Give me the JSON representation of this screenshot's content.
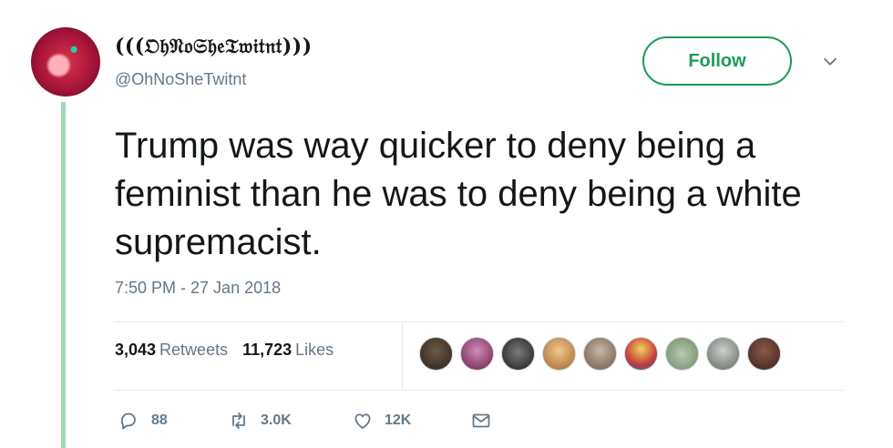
{
  "tweet": {
    "display_name": "(((𝔒𝔥𝔑𝔬𝔖𝔥𝔢𝔗𝔴𝔦𝔱𝔫𝔱)))",
    "handle": "@OhNoSheTwitnt",
    "follow_label": "Follow",
    "text": "Trump was way quicker to deny being a feminist than he was to deny being a white supremacist.",
    "timestamp": "7:50 PM - 27 Jan 2018",
    "retweets_count": "3,043",
    "retweets_label": "Retweets",
    "likes_count": "11,723",
    "likes_label": "Likes",
    "replies": "88",
    "retweets_short": "3.0K",
    "likes_short": "12K"
  },
  "icons": {
    "reply": "reply-icon",
    "retweet": "retweet-icon",
    "like": "heart-icon",
    "dm": "envelope-icon",
    "more": "chevron-down-icon"
  },
  "colors": {
    "accent": "#1c9b56",
    "thread_line": "#9fd9b5",
    "secondary_text": "#657786",
    "divider": "#e1e8ed"
  }
}
